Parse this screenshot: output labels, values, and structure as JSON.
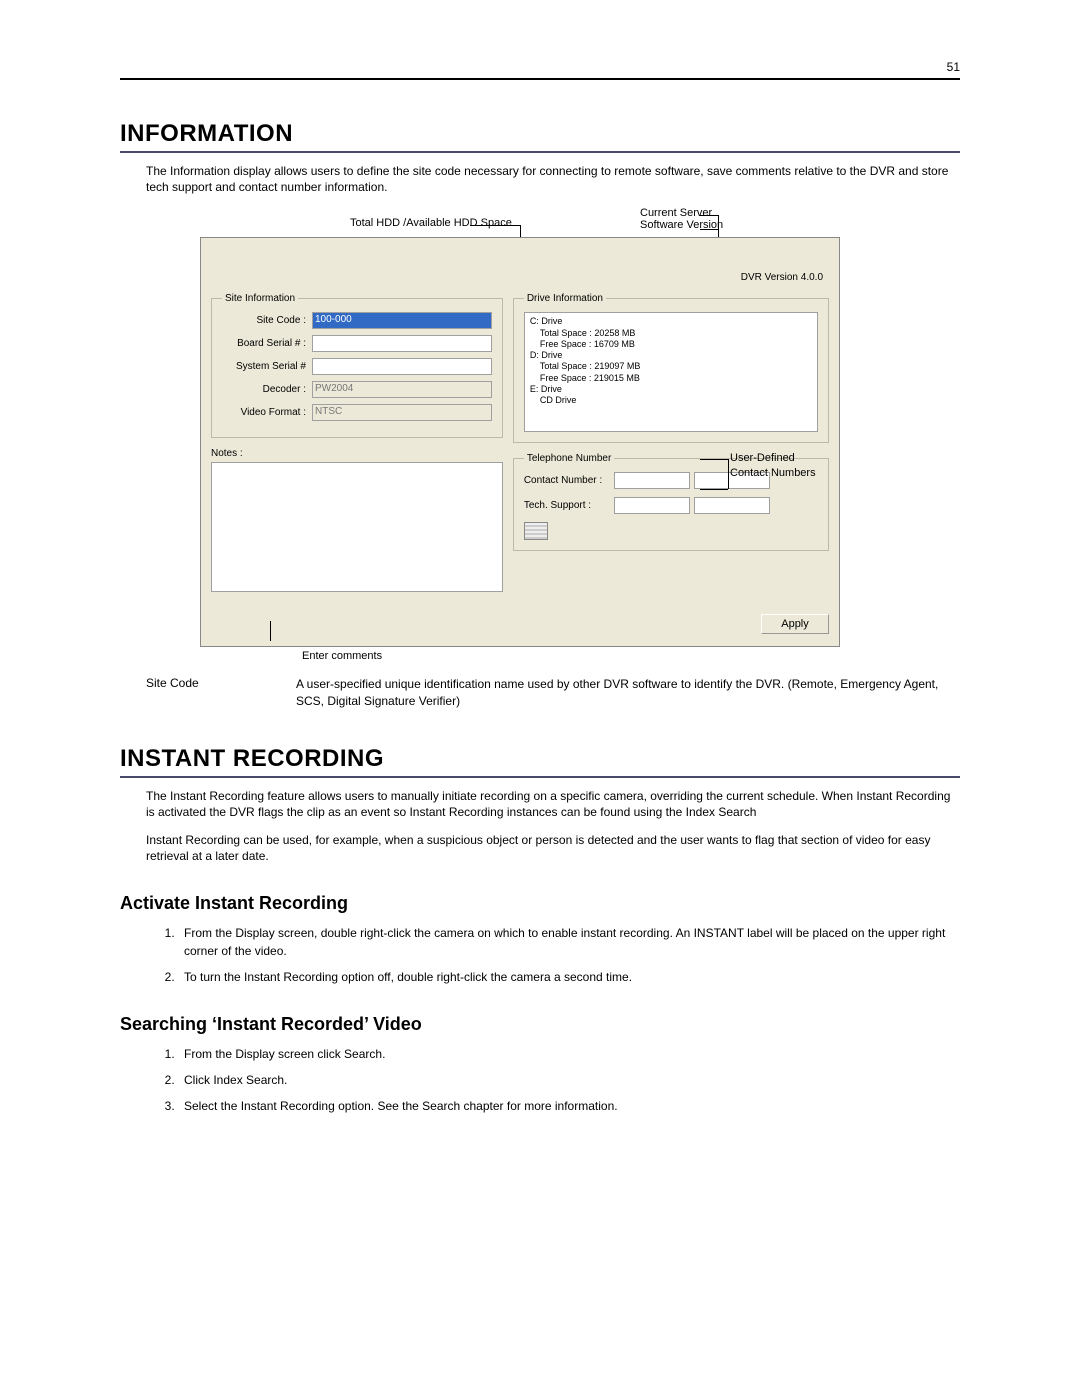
{
  "page_number": "51",
  "section1": {
    "heading": "INFORMATION",
    "intro": "The Information display allows users to define the site code necessary for connecting to remote software, save comments relative to the DVR and store tech support and contact number information."
  },
  "figure": {
    "callout_hdd": "Total HDD /Available HDD Space",
    "callout_current": "Current Server",
    "callout_version_sub": "Software Version",
    "callout_contacts_l1": "User-Defined",
    "callout_contacts_l2": "Contact Numbers",
    "callout_enter": "Enter comments",
    "version_text": "DVR Version 4.0.0",
    "site_info_legend": "Site Information",
    "site_code_label": "Site Code :",
    "site_code_value": "100-000",
    "board_serial_label": "Board Serial # :",
    "system_serial_label": "System Serial #",
    "decoder_label": "Decoder :",
    "decoder_value": "PW2004",
    "video_format_label": "Video Format :",
    "video_format_value": "NTSC",
    "notes_label": "Notes :",
    "drive_legend": "Drive Information",
    "drives": {
      "c_name": "C: Drive",
      "c_total": "Total Space : 20258 MB",
      "c_free": "Free Space : 16709 MB",
      "d_name": "D: Drive",
      "d_total": "Total Space : 219097 MB",
      "d_free": "Free Space : 219015 MB",
      "e_name": "E: Drive",
      "e_note": "CD Drive"
    },
    "phone_legend": "Telephone Number",
    "contact_label": "Contact Number :",
    "tech_label": "Tech. Support :",
    "apply_label": "Apply"
  },
  "def": {
    "term": "Site Code",
    "body": "A user-specified unique identification name used by other DVR software to identify the DVR. (Remote, Emergency Agent, SCS, Digital Signature Verifier)"
  },
  "section2": {
    "heading": "INSTANT RECORDING",
    "p1": "The Instant Recording feature allows users to manually initiate recording on a specific camera, overriding the current schedule.  When Instant Recording is activated the DVR flags the clip as an event so Instant Recording instances can be found using the Index Search",
    "p2": "Instant Recording can be used, for example, when a suspicious object or person is detected and the user wants to flag that section of video for easy retrieval at a later date.",
    "sub1": "Activate Instant Recording",
    "s1_step1": "From the Display screen, double right-click the camera on which to enable instant recording. An INSTANT label will be placed on the upper right corner of the video.",
    "s1_step2": "To turn the Instant Recording option off, double right-click the camera a second time.",
    "sub2": "Searching ‘Instant Recorded’ Video",
    "s2_step1": "From the Display screen click Search.",
    "s2_step2": "Click Index Search.",
    "s2_step3": "Select the Instant Recording option.  See the Search chapter for more information."
  }
}
